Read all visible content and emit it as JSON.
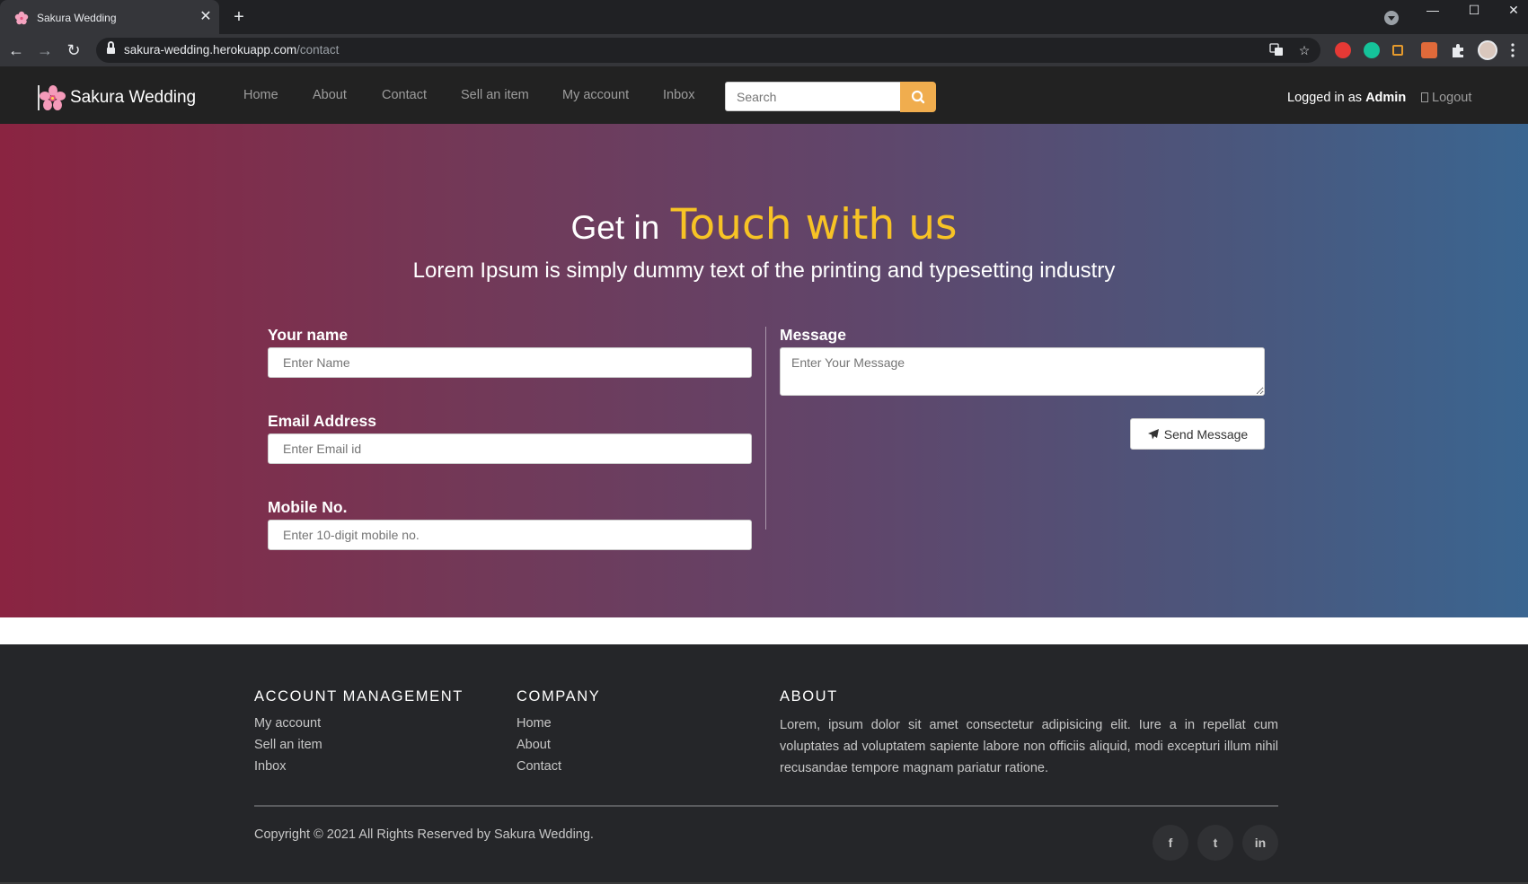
{
  "browser": {
    "tab_title": "Sakura Wedding",
    "tab_close": "✕",
    "new_tab": "+",
    "url_host": "sakura-wedding.herokuapp.com",
    "url_path": "/contact",
    "window_controls": {
      "minimize": "—",
      "maximize": "☐",
      "close": "✕"
    },
    "nav": {
      "back": "←",
      "forward": "→",
      "reload": "↻"
    },
    "omnibox_icons": [
      "translate-icon",
      "star-icon"
    ],
    "extension_icons": [
      "extension-red-icon",
      "grammarly-icon",
      "extension-orange-icon",
      "extension-figure-icon",
      "puzzle-icon",
      "profile-avatar-icon",
      "kebab-menu-icon"
    ]
  },
  "navbar": {
    "brand": "Sakura Wedding",
    "links": [
      "Home",
      "About",
      "Contact",
      "Sell an item",
      "My account",
      "Inbox"
    ],
    "search_placeholder": "Search",
    "logged_in_prefix": "Logged in as ",
    "logged_in_user": "Admin",
    "logout": "Logout"
  },
  "hero": {
    "title_plain": "Get in",
    "title_accent": "Touch with us",
    "subtitle": "Lorem Ipsum is simply dummy text of the printing and typesetting industry"
  },
  "form": {
    "name_label": "Your name",
    "name_placeholder": "Enter Name",
    "email_label": "Email Address",
    "email_placeholder": "Enter Email id",
    "mobile_label": "Mobile No.",
    "mobile_placeholder": "Enter 10-digit mobile no.",
    "message_label": "Message",
    "message_placeholder": "Enter Your Message",
    "send_label": "Send Message"
  },
  "footer": {
    "account_heading": "ACCOUNT MANAGEMENT",
    "account_links": [
      "My account",
      "Sell an item",
      "Inbox"
    ],
    "company_heading": "COMPANY",
    "company_links": [
      "Home",
      "About",
      "Contact"
    ],
    "about_heading": "ABOUT",
    "about_text": "Lorem, ipsum dolor sit amet consectetur adipisicing elit. Iure a in repellat cum voluptates ad voluptatem sapiente labore non officiis aliquid, modi excepturi illum nihil recusandae tempore magnam pariatur ratione.",
    "copyright": "Copyright © 2021 All Rights Reserved by Sakura Wedding.",
    "social": [
      {
        "icon": "facebook-icon",
        "glyph": "f"
      },
      {
        "icon": "twitter-icon",
        "glyph": "t"
      },
      {
        "icon": "linkedin-icon",
        "glyph": "in"
      }
    ]
  },
  "colors": {
    "navbar_bg": "#222222",
    "accent_yellow": "#f7c325",
    "search_button": "#f0ad4e",
    "gradient_start": "#8a2441",
    "gradient_end": "#3a6590",
    "footer_bg": "#252629"
  }
}
